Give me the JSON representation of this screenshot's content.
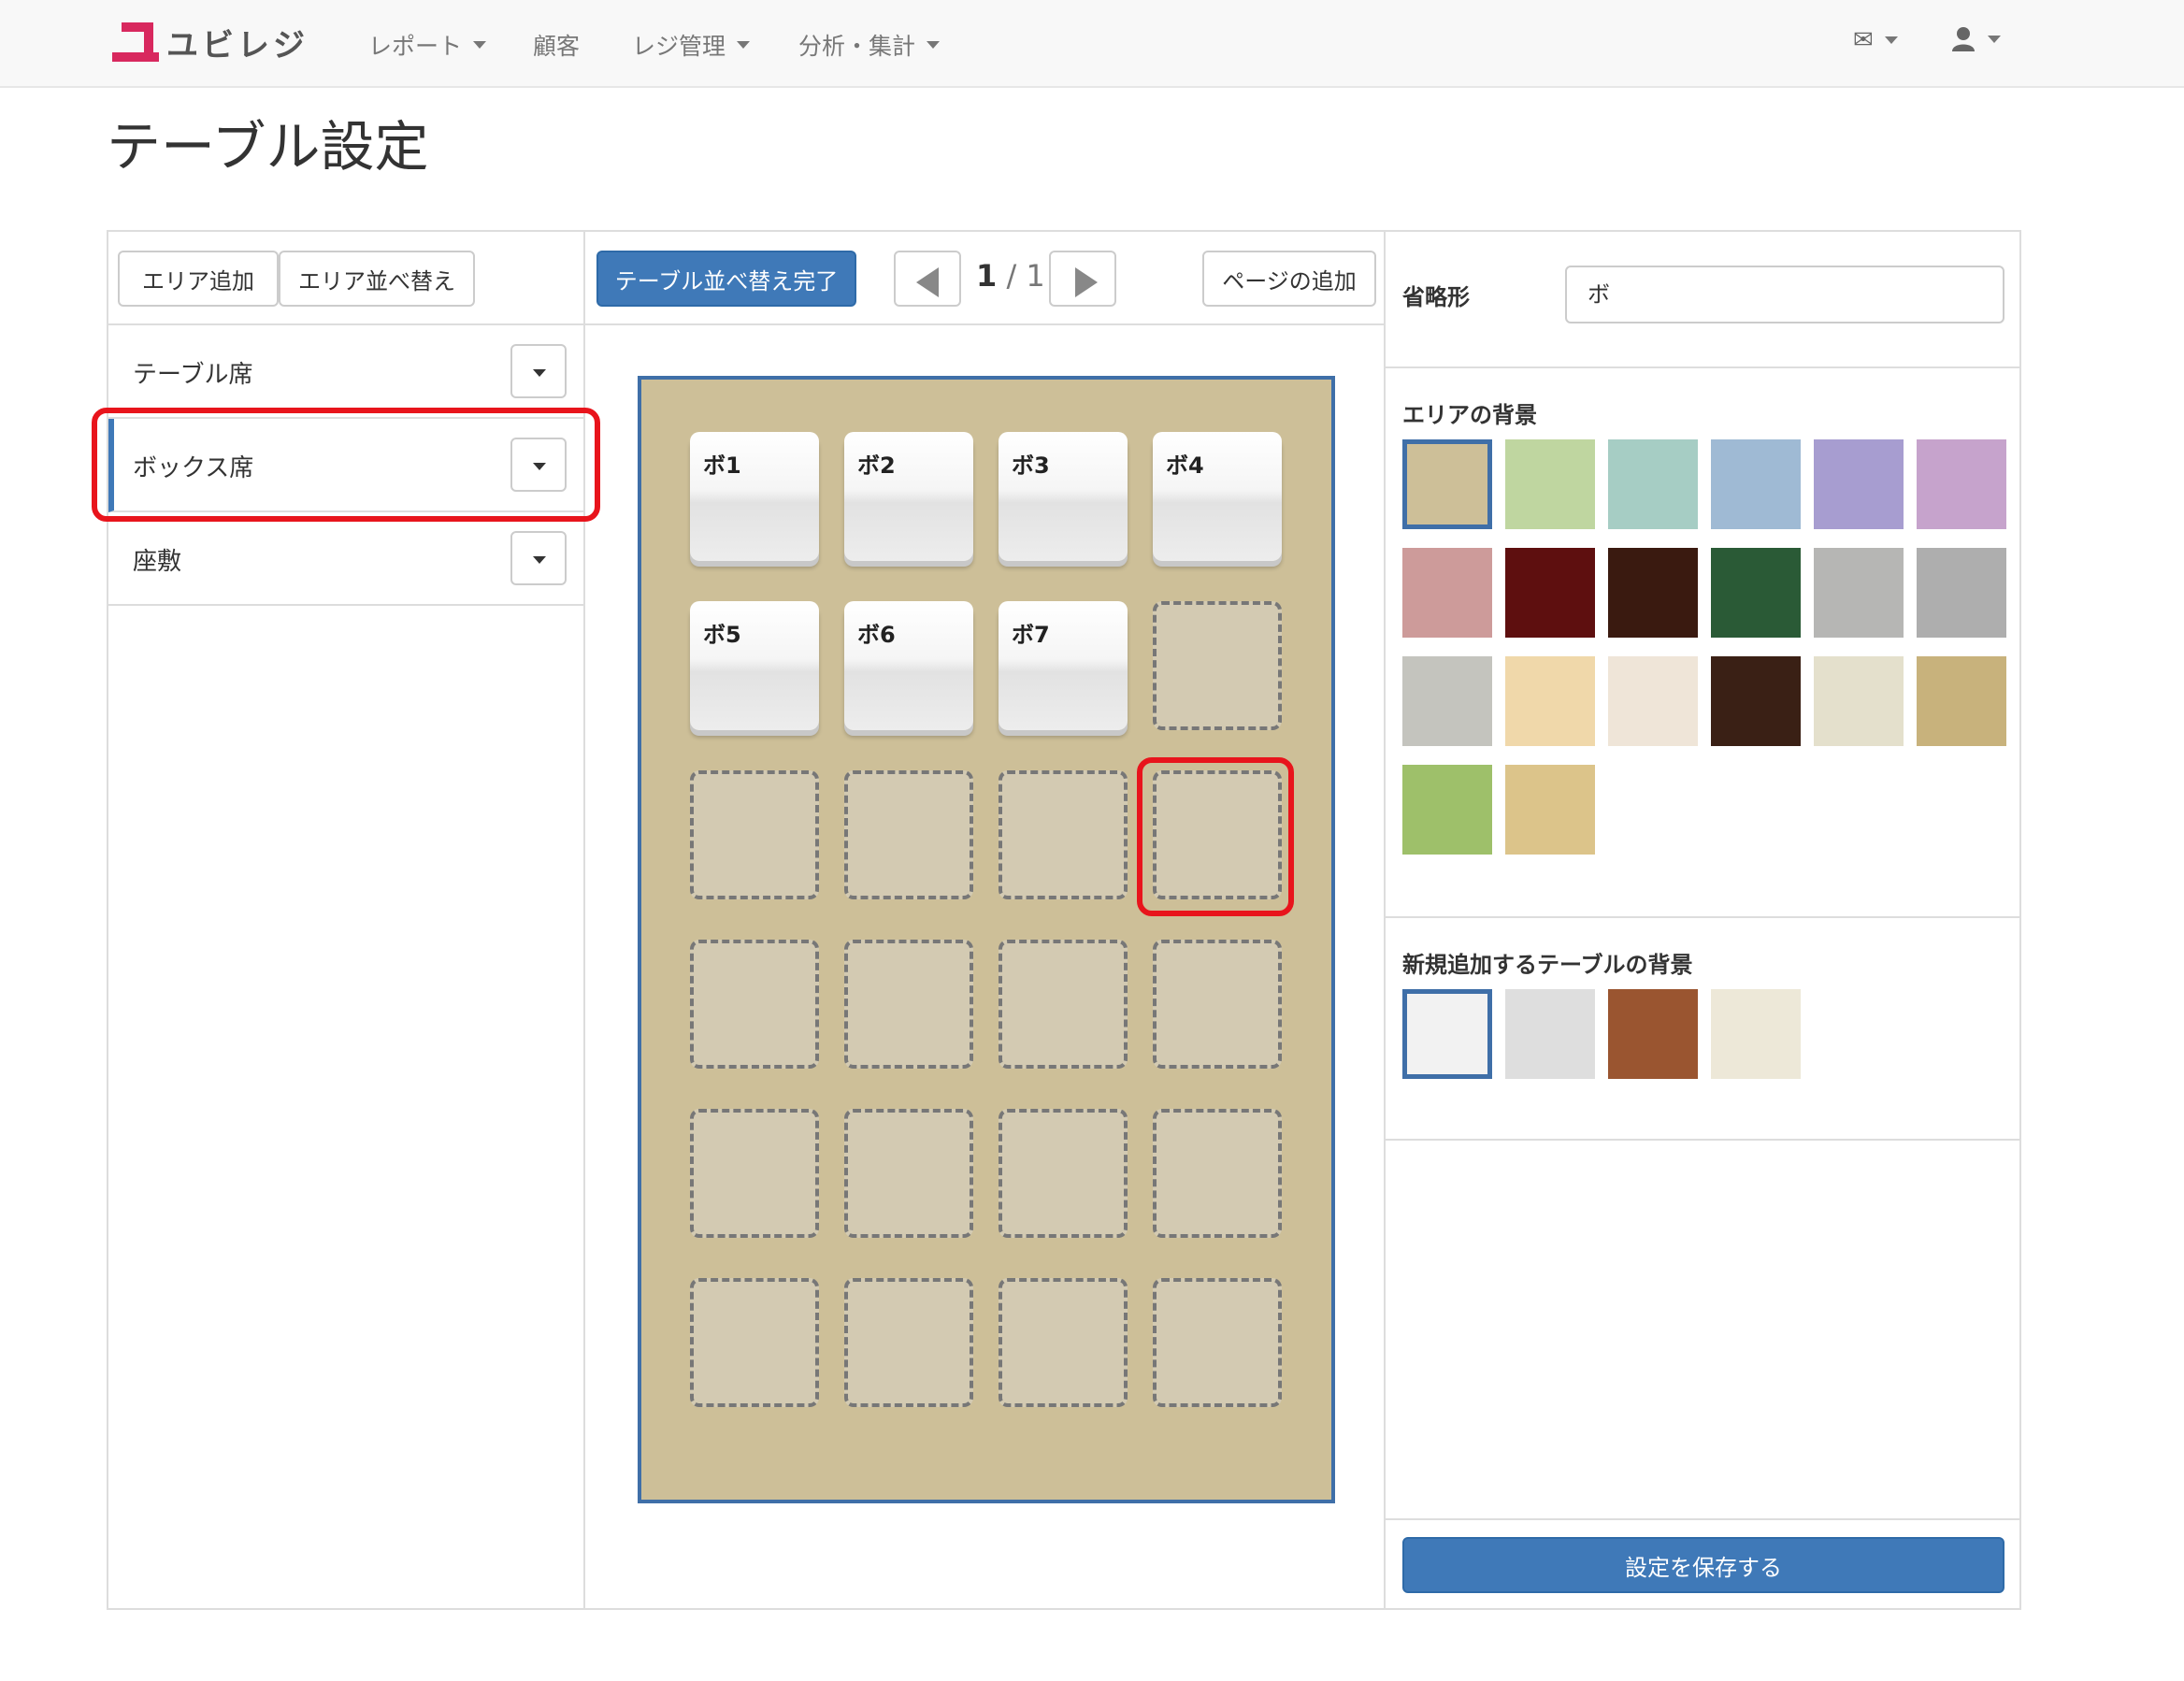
{
  "nav": {
    "brand": "ユビレジ",
    "items": [
      {
        "label": "レポート",
        "dropdown": true
      },
      {
        "label": "顧客",
        "dropdown": false
      },
      {
        "label": "レジ管理",
        "dropdown": true
      },
      {
        "label": "分析・集計",
        "dropdown": true
      }
    ],
    "mail_icon": "envelope-icon",
    "user_icon": "user-icon"
  },
  "page": {
    "title": "テーブル設定"
  },
  "areas": {
    "add_label": "エリア追加",
    "sort_label": "エリア並べ替え",
    "items": [
      {
        "label": "テーブル席",
        "active": false
      },
      {
        "label": "ボックス席",
        "active": true
      },
      {
        "label": "座敷",
        "active": false
      }
    ]
  },
  "layout_toolbar": {
    "sort_done_label": "テーブル並べ替え完了",
    "page_current": "1",
    "page_sep": "/",
    "page_total": "1",
    "add_page_label": "ページの追加"
  },
  "canvas": {
    "background_color": "#cdbf98",
    "tables": [
      {
        "name": "ボ1",
        "row": 0,
        "col": 0
      },
      {
        "name": "ボ2",
        "row": 0,
        "col": 1
      },
      {
        "name": "ボ3",
        "row": 0,
        "col": 2
      },
      {
        "name": "ボ4",
        "row": 0,
        "col": 3
      },
      {
        "name": "ボ5",
        "row": 1,
        "col": 0
      },
      {
        "name": "ボ6",
        "row": 1,
        "col": 1
      },
      {
        "name": "ボ7",
        "row": 1,
        "col": 2
      }
    ],
    "grid": {
      "rows": 6,
      "cols": 4
    }
  },
  "settings": {
    "abbr_label": "省略形",
    "abbr_value": "ボ",
    "area_bg_label": "エリアの背景",
    "area_bg_colors": [
      "#cdbf98",
      "#bfd6a0",
      "#a6cdc4",
      "#9fbad4",
      "#a79dd0",
      "#c6a3cc",
      "#cd9b9a",
      "#5e0f0f",
      "#3a1a10",
      "#2a5a36",
      "#b6b6b4",
      "#aeaeae",
      "#c4c4be",
      "#f0d8aa",
      "#efe5d8",
      "#3a2015",
      "#e4e0cc",
      "#c8b27c",
      "#9ec06a",
      "#dcc48a"
    ],
    "area_bg_selected": 0,
    "table_bg_label": "新規追加するテーブルの背景",
    "table_bg_colors": [
      "#f2f2f2",
      "#dedede",
      "#9a5530",
      "#ede8d8"
    ],
    "table_bg_selected": 0,
    "save_label": "設定を保存する"
  }
}
